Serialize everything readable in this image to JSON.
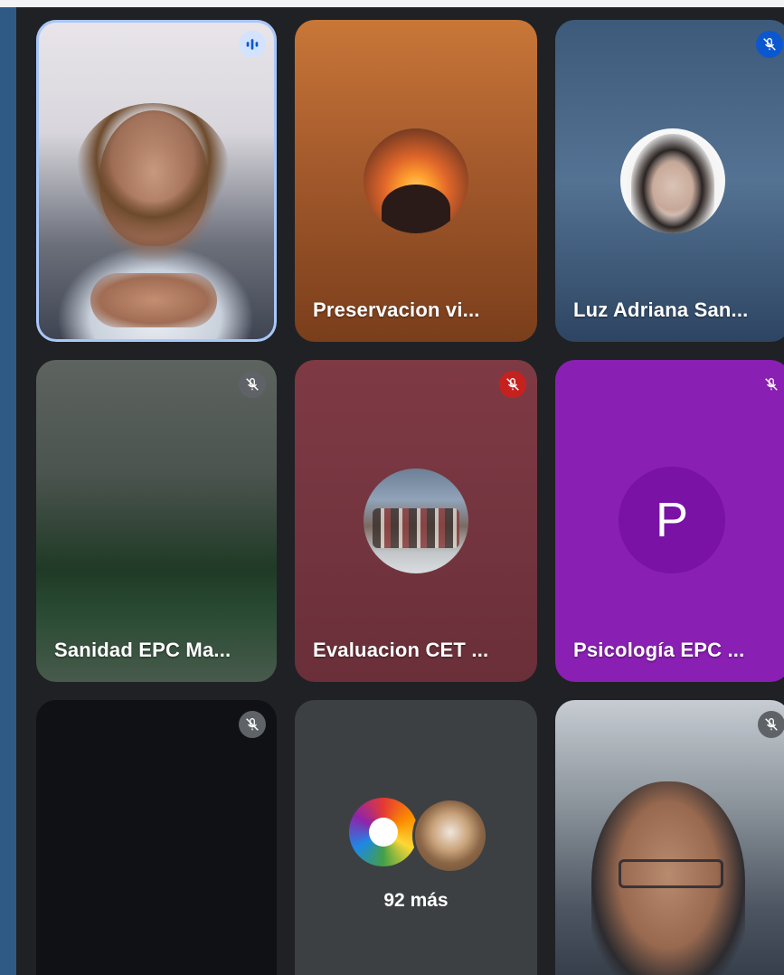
{
  "tiles": [
    {
      "name": "",
      "mic": "speaking"
    },
    {
      "name": "Preservacion vi...",
      "mic": "none"
    },
    {
      "name": "Luz Adriana San...",
      "mic": "muted"
    },
    {
      "name": "Sanidad EPC Ma...",
      "mic": "muted"
    },
    {
      "name": "Evaluacion CET ...",
      "mic": "muted-red"
    },
    {
      "name": "Psicología EPC ...",
      "mic": "muted",
      "initial": "P"
    },
    {
      "name": "",
      "mic": "muted"
    },
    {
      "name": "",
      "mic": "none",
      "more_label": "92 más"
    },
    {
      "name": "",
      "mic": "muted"
    }
  ],
  "colors": {
    "grid_bg": "#202124",
    "page_bg": "#2f5a86",
    "active_border": "#a8c7fa",
    "muted_red": "#c5221f",
    "purple_tile": "#8a1fb3"
  },
  "icons": [
    "speaking-indicator-icon",
    "mic-off-icon"
  ]
}
